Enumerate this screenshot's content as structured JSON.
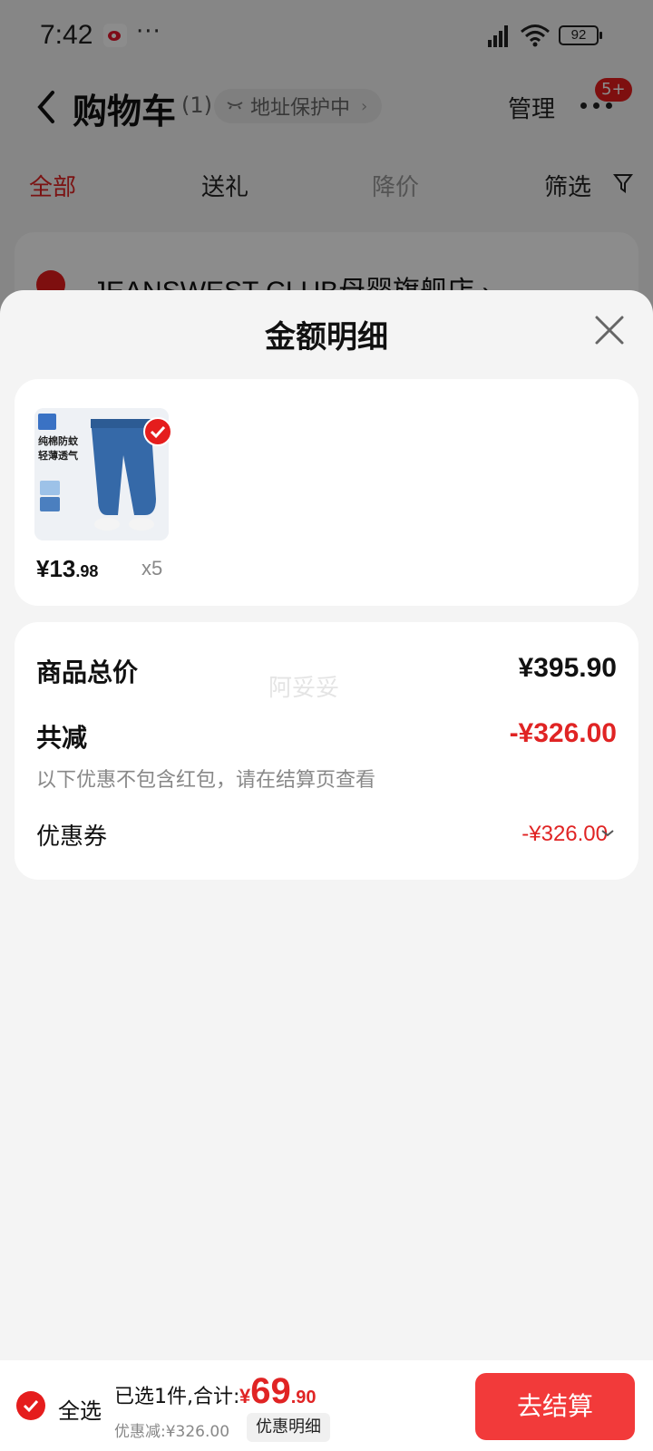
{
  "status_bar": {
    "time": "7:42",
    "dots": "···",
    "battery": "92"
  },
  "nav": {
    "title": "购物车",
    "count": "(1)",
    "address_label": "地址保护中",
    "manage_label": "管理",
    "badge": "5+"
  },
  "filter_tabs": [
    {
      "label": "全部",
      "active": true
    },
    {
      "label": "送礼",
      "active": false
    },
    {
      "label": "降价",
      "active": false,
      "muted": true
    },
    {
      "label": "筛选",
      "active": false
    }
  ],
  "shop": {
    "name": "JEANSWEST CLUB母婴旗舰店 ›"
  },
  "sheet": {
    "title": "金额明细",
    "item": {
      "thumb_lines": [
        "纯棉防蚊",
        "轻薄透气"
      ],
      "price_int": "¥13",
      "price_dec": ".98",
      "qty": "x5"
    },
    "summary": {
      "total_label": "商品总价",
      "total_value": "¥395.90",
      "watermark": "阿妥妥",
      "reduce_label": "共减",
      "reduce_value": "-¥326.00",
      "reduce_note": "以下优惠不包含红包，请在结算页查看",
      "coupon_label": "优惠券",
      "coupon_value": "-¥326.00"
    }
  },
  "checkout": {
    "select_all": "全选",
    "selected_text": "已选1件,合计:",
    "total_sym": "¥",
    "total_int": "69",
    "total_dec": ".90",
    "discount_text": "优惠减:¥326.00",
    "detail_label": "优惠明细",
    "button_label": "去结算"
  },
  "colors": {
    "accent": "#e51d1d",
    "button": "#f23a3a",
    "text": "#111111"
  }
}
